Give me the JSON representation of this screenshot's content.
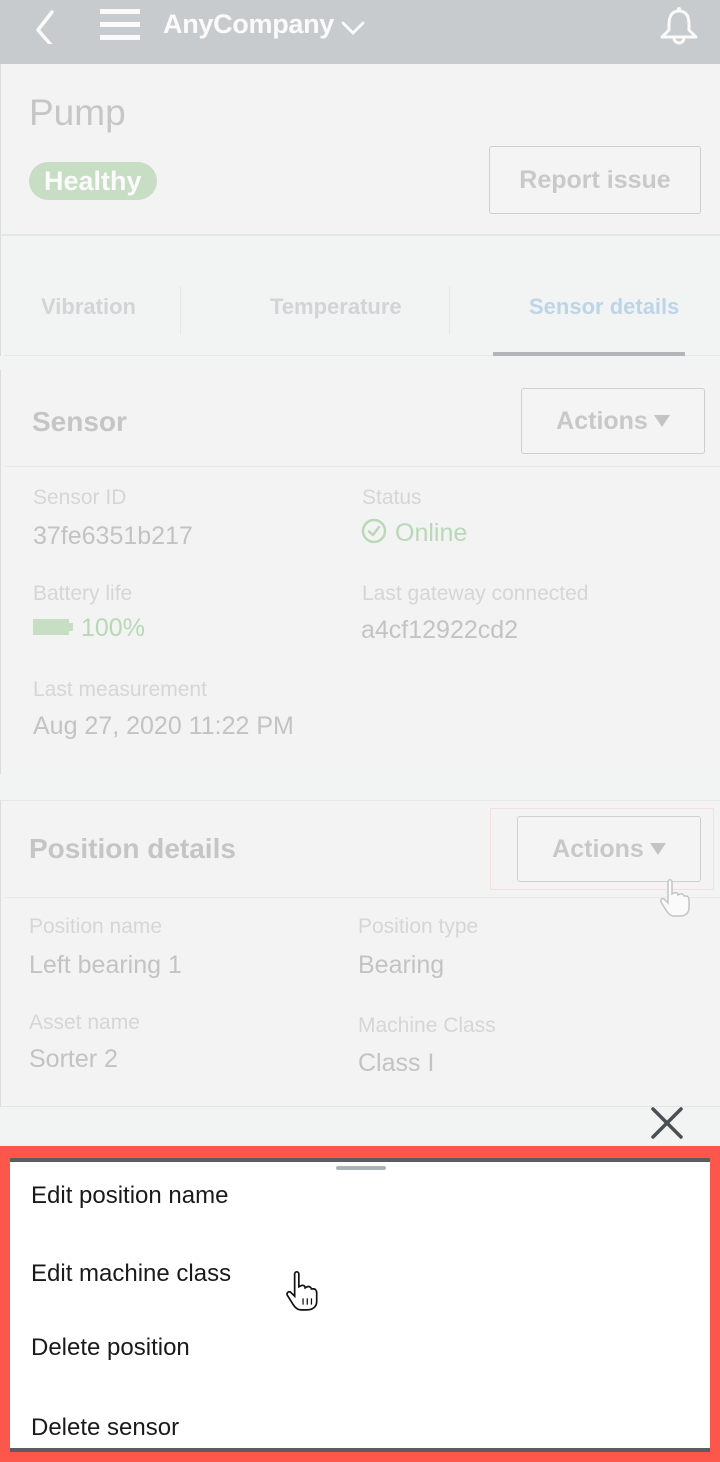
{
  "topbar": {
    "company": "AnyCompany",
    "icons": {
      "back": "chevron-left-icon",
      "menu": "hamburger-menu-icon",
      "company_dropdown": "chevron-down-icon",
      "notifications": "bell-icon"
    }
  },
  "header": {
    "title": "Pump",
    "status_badge": "Healthy",
    "report_button": "Report issue"
  },
  "tabs": [
    {
      "label": "Vibration",
      "active": false
    },
    {
      "label": "Temperature",
      "active": false
    },
    {
      "label": "Sensor details",
      "active": true
    }
  ],
  "sensor": {
    "title": "Sensor",
    "actions_label": "Actions",
    "fields": {
      "sensor_id": {
        "label": "Sensor ID",
        "value": "37fe6351b217"
      },
      "status": {
        "label": "Status",
        "value": "Online",
        "icon": "check-circle-icon"
      },
      "battery": {
        "label": "Battery life",
        "value": "100%",
        "percent": 100,
        "icon": "battery-icon"
      },
      "gateway": {
        "label": "Last gateway connected",
        "value": "a4cf12922cd2"
      },
      "last_measurement": {
        "label": "Last measurement",
        "value": "Aug 27, 2020 11:22 PM"
      }
    }
  },
  "position": {
    "title": "Position details",
    "actions_label": "Actions",
    "fields": {
      "position_name": {
        "label": "Position name",
        "value": "Left bearing 1"
      },
      "position_type": {
        "label": "Position type",
        "value": "Bearing"
      },
      "asset_name": {
        "label": "Asset name",
        "value": "Sorter 2"
      },
      "machine_class": {
        "label": "Machine Class",
        "value": "Class I"
      }
    }
  },
  "bottom_sheet": {
    "items": [
      {
        "label": "Edit position name"
      },
      {
        "label": "Edit machine class"
      },
      {
        "label": "Delete position"
      },
      {
        "label": "Delete sensor"
      }
    ]
  },
  "colors": {
    "topbar": "#c8cbce",
    "healthy": "#c7ddc4",
    "online_green": "#b9d8b6",
    "active_tab": "#bcd5e9",
    "highlight_red": "#fc574a"
  }
}
